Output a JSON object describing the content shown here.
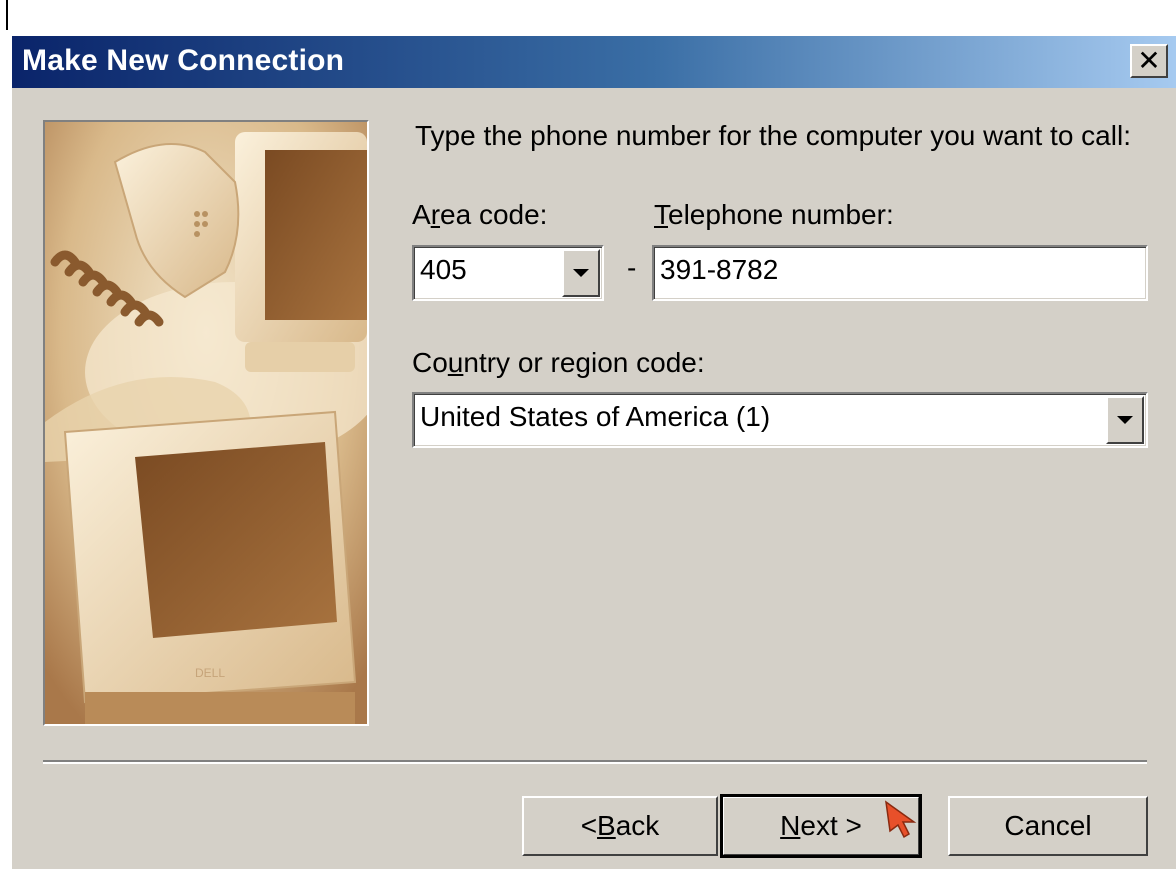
{
  "window": {
    "title": "Make New Connection",
    "close_label": "✕"
  },
  "colors": {
    "title_gradient_start": "#0a246a",
    "title_gradient_end": "#a6caf0",
    "face": "#d4d0c8",
    "cursor": "#e8502a"
  },
  "illustration": {
    "icon": "computer-and-phone-illustration"
  },
  "prompt": "Type the phone number for the computer you want to call:",
  "area_code": {
    "label_pre": "A",
    "label_access": "r",
    "label_post": "ea code:",
    "value": "405"
  },
  "dash": "-",
  "telephone": {
    "label_access": "T",
    "label_post": "elephone number:",
    "value": "391-8782"
  },
  "country": {
    "label_pre": "Co",
    "label_access": "u",
    "label_post": "ntry or region code:",
    "value": "United States of America (1)"
  },
  "buttons": {
    "back": {
      "pre": "< ",
      "access": "B",
      "post": "ack"
    },
    "next": {
      "access": "N",
      "post": "ext >"
    },
    "cancel": "Cancel"
  },
  "cursor_icon": "mouse-pointer-icon"
}
